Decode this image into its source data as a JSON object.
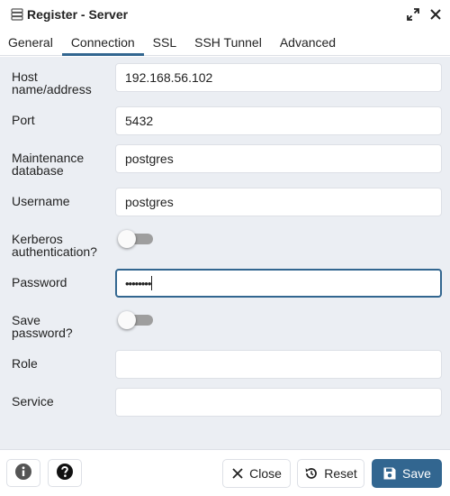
{
  "dialog": {
    "title": "Register - Server",
    "icons": [
      "server-icon",
      "expand-icon"
    ]
  },
  "tabs": [
    {
      "label": "General",
      "active": false
    },
    {
      "label": "Connection",
      "active": true
    },
    {
      "label": "SSL",
      "active": false
    },
    {
      "label": "SSH Tunnel",
      "active": false
    },
    {
      "label": "Advanced",
      "active": false
    }
  ],
  "form": {
    "host": {
      "label_line1": "Host",
      "label_line2": "name/address",
      "value": "192.168.56.102"
    },
    "port": {
      "label": "Port",
      "value": "5432"
    },
    "maintenance_db": {
      "label_line1": "Maintenance",
      "label_line2": "database",
      "value": "postgres"
    },
    "username": {
      "label": "Username",
      "value": "postgres"
    },
    "kerberos": {
      "label_line1": "Kerberos",
      "label_line2": "authentication?",
      "checked": false
    },
    "password": {
      "label": "Password",
      "value_masked": "••••••••"
    },
    "save_password": {
      "label_line1": "Save",
      "label_line2": "password?",
      "checked": false
    },
    "role": {
      "label": "Role",
      "value": ""
    },
    "service": {
      "label": "Service",
      "value": ""
    }
  },
  "footer": {
    "info_icon": "info-icon",
    "help_icon": "help-icon",
    "close_label": "Close",
    "reset_label": "Reset",
    "save_label": "Save"
  },
  "colors": {
    "accent": "#326690",
    "form_background": "#ebeef3",
    "border": "#dde0e6",
    "toggle_off": "#9e9e9e"
  }
}
